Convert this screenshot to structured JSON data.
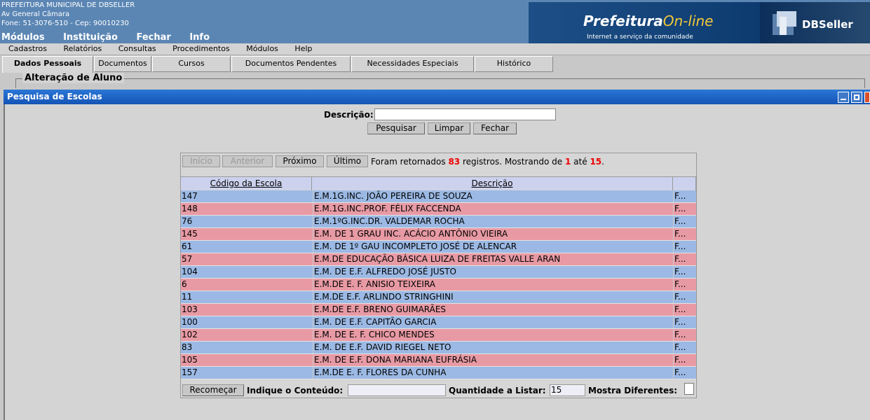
{
  "header": {
    "org_name": "PREFEITURA MUNICIPAL DE DBSELLER",
    "address": "Av General Câmara",
    "phone_cep": "Fone: 51-3076-510  -  Cep: 90010230",
    "menu": [
      "Módulos",
      "Instituição",
      "Fechar",
      "Info"
    ],
    "brand_main": "Prefeitura",
    "brand_accent": "On-line",
    "brand_tagline": "Internet a serviço da comunidade",
    "dbseller_logo_text": "DBSeller"
  },
  "menubar": [
    "Cadastros",
    "Relatórios",
    "Consultas",
    "Procedimentos",
    "Módulos",
    "Help"
  ],
  "tabs": [
    "Dados Pessoais",
    "Documentos",
    "Cursos",
    "Documentos Pendentes",
    "Necessidades Especiais",
    "Histórico"
  ],
  "fieldset_legend": "Alteração de Aluno",
  "window": {
    "title": "Pesquisa de Escolas",
    "search_label": "Descrição:",
    "search_value": "",
    "buttons": {
      "search": "Pesquisar",
      "clear": "Limpar",
      "close": "Fechar"
    }
  },
  "pagination": {
    "first": "Início",
    "prev": "Anterior",
    "next": "Próximo",
    "last": "Último",
    "msg_prefix": "Foram retornados",
    "total": "83",
    "msg_middle": "registros. Mostrando de",
    "from": "1",
    "msg_until": "até",
    "to": "15",
    "msg_end": "."
  },
  "table": {
    "columns": [
      "Código da Escola",
      "Descrição",
      ""
    ],
    "rows": [
      [
        "147",
        "E.M.1G.INC. JOÃO PEREIRA DE SOUZA",
        "F..."
      ],
      [
        "148",
        "E.M.1G.INC.PROF. FÉLIX FACCENDA",
        "F..."
      ],
      [
        "76",
        "E.M.1ºG.INC.DR. VALDEMAR ROCHA",
        "F..."
      ],
      [
        "145",
        "E.M. DE 1 GRAU INC. ACÁCIO ANTÔNIO VIEIRA",
        "F..."
      ],
      [
        "61",
        "E.M. DE 1º GAU INCOMPLETO JOSÉ DE ALENCAR",
        "F..."
      ],
      [
        "57",
        "E.M.DE EDUCAÇÃO BÁSICA LUIZA DE FREITAS VALLE ARAN",
        "F..."
      ],
      [
        "104",
        "E.M. DE E.F. ALFREDO JOSÉ JUSTO",
        "F..."
      ],
      [
        "6",
        "E.M.DE E. F. ANISIO TEIXEIRA",
        "F..."
      ],
      [
        "11",
        "E.M.DE E.F. ARLINDO STRINGHINI",
        "F..."
      ],
      [
        "103",
        "E.M.DE E.F. BRENO GUIMARÃES",
        "F..."
      ],
      [
        "100",
        "E.M. DE E.F. CAPITÃO GARCIA",
        "F..."
      ],
      [
        "102",
        "E.M. DE E. F. CHICO MENDES",
        "F..."
      ],
      [
        "83",
        "E.M. DE E.F. DAVID RIEGEL NETO",
        "F..."
      ],
      [
        "105",
        "E.M. DE E.F. DONA MARIANA EUFRÁSIA",
        "F..."
      ],
      [
        "157",
        "E.M.DE E. F. FLORES DA CUNHA",
        "F..."
      ]
    ]
  },
  "footer": {
    "restart": "Recomeçar",
    "content_label": "Indique o Conteúdo:",
    "content_value": "",
    "quantity_label": "Quantidade a Listar:",
    "quantity_value": "15",
    "distinct_label": "Mostra Diferentes:"
  },
  "colors": {
    "row_blue": "#9bb9e4",
    "row_pink": "#e89aa4",
    "title_bar": "#1a64c8",
    "count_red": "#e00000"
  }
}
